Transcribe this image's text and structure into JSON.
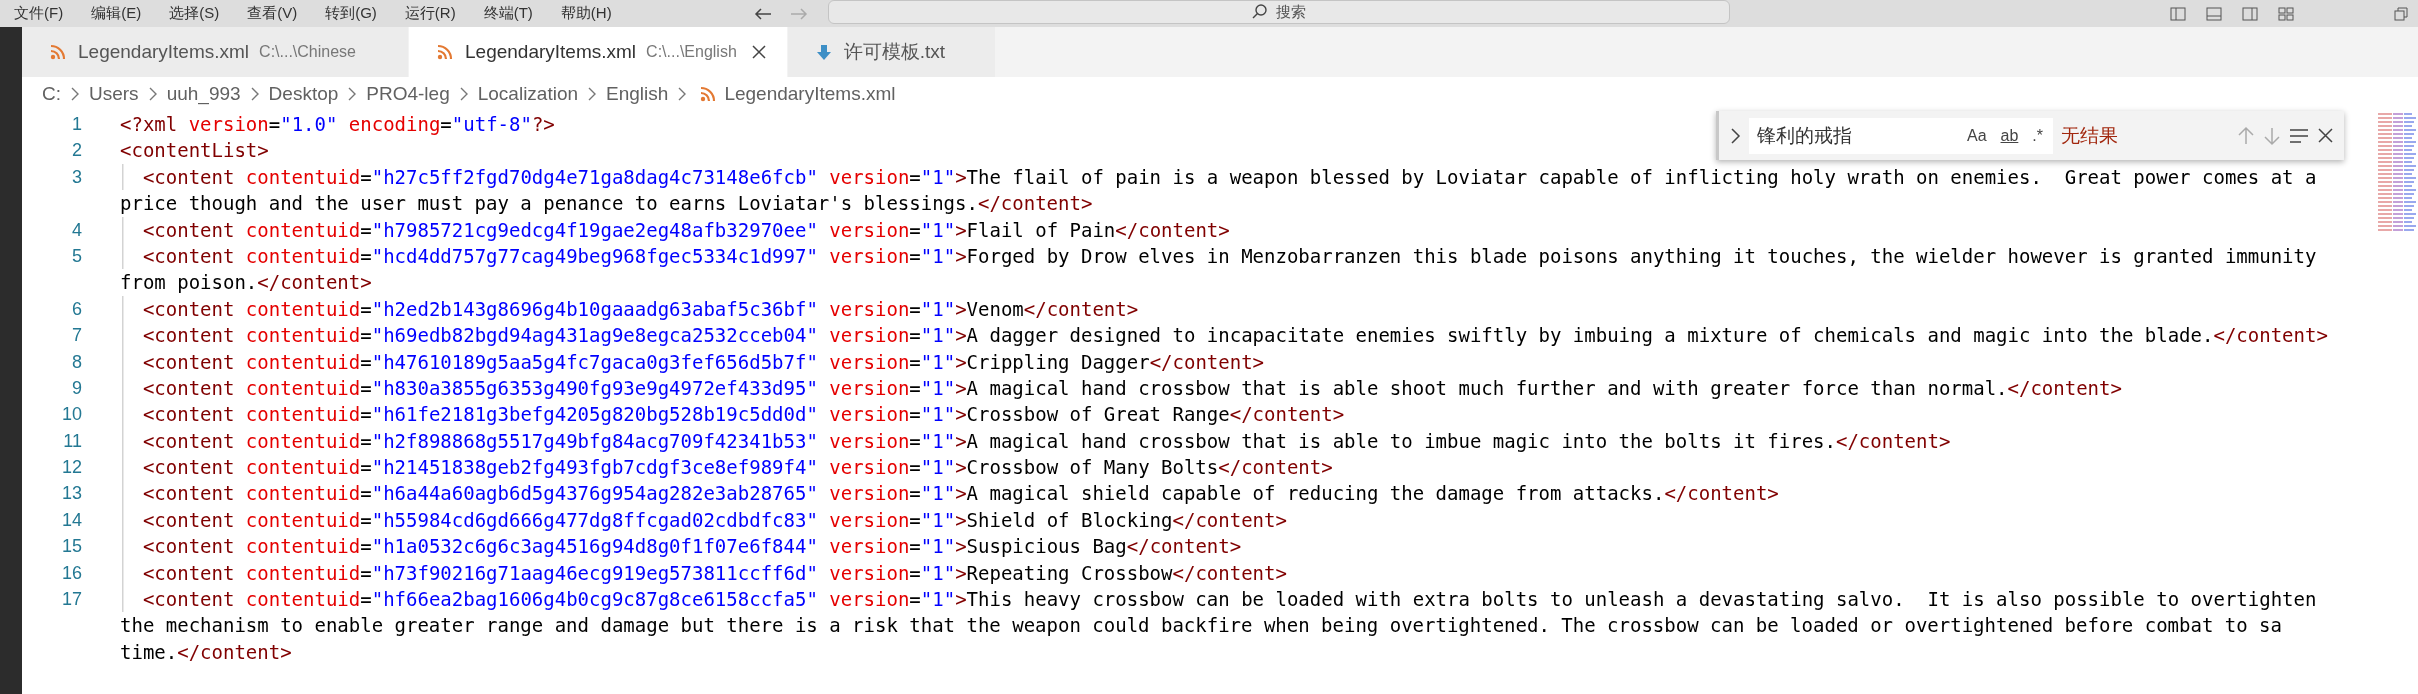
{
  "menu": [
    "文件(F)",
    "编辑(E)",
    "选择(S)",
    "查看(V)",
    "转到(G)",
    "运行(R)",
    "终端(T)",
    "帮助(H)"
  ],
  "title_search": {
    "placeholder": "搜索"
  },
  "tabs": [
    {
      "name": "LegendaryItems.xml",
      "path": "C:\\...\\Chinese",
      "kind": "xml",
      "selected": false
    },
    {
      "name": "LegendaryItems.xml",
      "path": "C:\\...\\English",
      "kind": "xml",
      "selected": true
    },
    {
      "name": "许可模板.txt",
      "kind": "download",
      "selected": false
    }
  ],
  "breadcrumb": {
    "folders": [
      "C:",
      "Users",
      "uuh_993",
      "Desktop",
      "PRO4-leg",
      "Localization",
      "English"
    ],
    "file": "LegendaryItems.xml"
  },
  "find": {
    "value": "锋利的戒指",
    "toggles": [
      "Aa",
      "ab",
      ".*"
    ],
    "status": "无结果"
  },
  "lines": [
    {
      "number": "1",
      "rows": [
        "<?xml version=\"1.0\" encoding=\"utf-8\"?>"
      ]
    },
    {
      "number": "2",
      "rows": [
        "<contentList>"
      ]
    },
    {
      "number": "3",
      "rows": [
        "  <content contentuid=\"h27c5ff2fgd70dg4e71ga8dag4c73148e6fcb\" version=\"1\">The flail of pain is a weapon blessed by Loviatar capable of inflicting holy wrath on enemies.  Great power comes at a",
        "price though and the user must pay a penance to earns Loviatar's blessings.</content>"
      ]
    },
    {
      "number": "4",
      "rows": [
        "  <content contentuid=\"h7985721cg9edcg4f19gae2eg48afb32970ee\" version=\"1\">Flail of Pain</content>"
      ]
    },
    {
      "number": "5",
      "rows": [
        "  <content contentuid=\"hcd4dd757g77cag49beg968fgec5334c1d997\" version=\"1\">Forged by Drow elves in Menzobarranzen this blade poisons anything it touches, the wielder however is granted immunity",
        "from poison.</content>"
      ]
    },
    {
      "number": "6",
      "rows": [
        "  <content contentuid=\"h2ed2b143g8696g4b10gaaadg63abaf5c36bf\" version=\"1\">Venom</content>"
      ]
    },
    {
      "number": "7",
      "rows": [
        "  <content contentuid=\"h69edb82bgd94ag431ag9e8egca2532cceb04\" version=\"1\">A dagger designed to incapacitate enemies swiftly by imbuing a mixture of chemicals and magic into the blade.</content>"
      ]
    },
    {
      "number": "8",
      "rows": [
        "  <content contentuid=\"h47610189g5aa5g4fc7gaca0g3fef656d5b7f\" version=\"1\">Crippling Dagger</content>"
      ]
    },
    {
      "number": "9",
      "rows": [
        "  <content contentuid=\"h830a3855g6353g490fg93e9g4972ef433d95\" version=\"1\">A magical hand crossbow that is able shoot much further and with greater force than normal.</content>"
      ]
    },
    {
      "number": "10",
      "rows": [
        "  <content contentuid=\"h61fe2181g3befg4205g820bg528b19c5dd0d\" version=\"1\">Crossbow of Great Range</content>"
      ]
    },
    {
      "number": "11",
      "rows": [
        "  <content contentuid=\"h2f898868g5517g49bfg84acg709f42341b53\" version=\"1\">A magical hand crossbow that is able to imbue magic into the bolts it fires.</content>"
      ]
    },
    {
      "number": "12",
      "rows": [
        "  <content contentuid=\"h21451838geb2fg493fgb7cdgf3ce8ef989f4\" version=\"1\">Crossbow of Many Bolts</content>"
      ]
    },
    {
      "number": "13",
      "rows": [
        "  <content contentuid=\"h6a44a60agb6d5g4376g954ag282e3ab28765\" version=\"1\">A magical shield capable of reducing the damage from attacks.</content>"
      ]
    },
    {
      "number": "14",
      "rows": [
        "  <content contentuid=\"h55984cd6gd666g477dg8ffcgad02cdbdfc83\" version=\"1\">Shield of Blocking</content>"
      ]
    },
    {
      "number": "15",
      "rows": [
        "  <content contentuid=\"h1a0532c6g6c3ag4516g94d8g0f1f07e6f844\" version=\"1\">Suspicious Bag</content>"
      ]
    },
    {
      "number": "16",
      "rows": [
        "  <content contentuid=\"h73f90216g71aag46ecg919eg573811ccff6d\" version=\"1\">Repeating Crossbow</content>"
      ]
    },
    {
      "number": "17",
      "rows": [
        "  <content contentuid=\"hf66ea2bag1606g4b0cg9c87g8ce6158ccfa5\" version=\"1\">This heavy crossbow can be loaded with extra bolts to unleash a devastating salvo.  It is also possible to overtighten",
        "the mechanism to enable greater range and damage but there is a risk that the weapon could backfire when being overtightened. The crossbow can be loaded or overtightened before combat to sa",
        "time.</content>"
      ]
    }
  ]
}
